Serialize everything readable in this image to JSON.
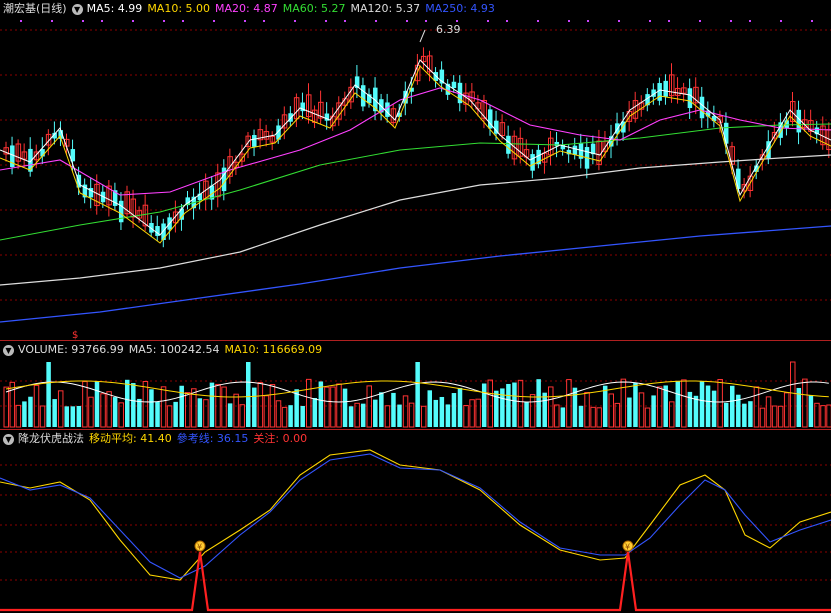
{
  "main": {
    "title": "潮宏基(日线)",
    "ma": [
      {
        "label": "MA5: 4.99",
        "color": "#ffffff"
      },
      {
        "label": "MA10: 5.00",
        "color": "#ffd700"
      },
      {
        "label": "MA20: 4.87",
        "color": "#ff40ff"
      },
      {
        "label": "MA60: 5.27",
        "color": "#33dd33"
      },
      {
        "label": "MA120: 5.37",
        "color": "#dddddd"
      },
      {
        "label": "MA250: 4.93",
        "color": "#3355ff"
      }
    ],
    "high_marker": "6.39"
  },
  "volume": {
    "title": "VOLUME: 93766.99",
    "ma5": "MA5: 100242.54",
    "ma10": "MA10: 116669.09"
  },
  "indicator": {
    "title": "降龙伏虎战法",
    "move_avg": "移动平均: 41.40",
    "pressure": "參考线: 36.15",
    "focus": "关注: 0.00"
  },
  "colors": {
    "up": "#ff3333",
    "down": "#54fcfc",
    "grid": "#8b0000",
    "sep": "#b02020"
  }
}
